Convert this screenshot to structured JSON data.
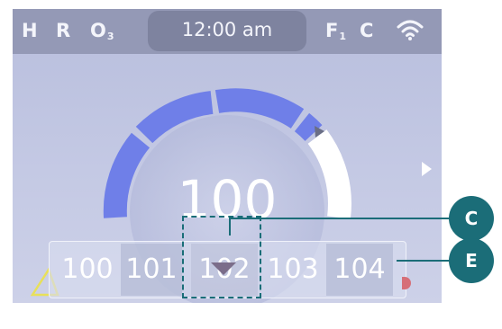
{
  "status_bar": {
    "indicators_left": [
      "H",
      "R",
      "O"
    ],
    "o_subscript": "3",
    "time": "12:00 am",
    "indicator_f": "F",
    "f_subscript": "1",
    "indicator_c": "C",
    "wifi_icon": "wifi-icon"
  },
  "dial": {
    "current_temp": "100"
  },
  "ribbon": {
    "values": [
      "100",
      "101",
      "102",
      "103",
      "104"
    ],
    "selected_index": 2
  },
  "callouts": {
    "c": "C",
    "e": "E"
  },
  "colors": {
    "gauge_fill": "#6f7fe8",
    "gauge_remaining": "#ffffff",
    "callout": "#1b6d78",
    "warning_triangle": "#e8e05a",
    "limit_marker": "#d66f78"
  }
}
